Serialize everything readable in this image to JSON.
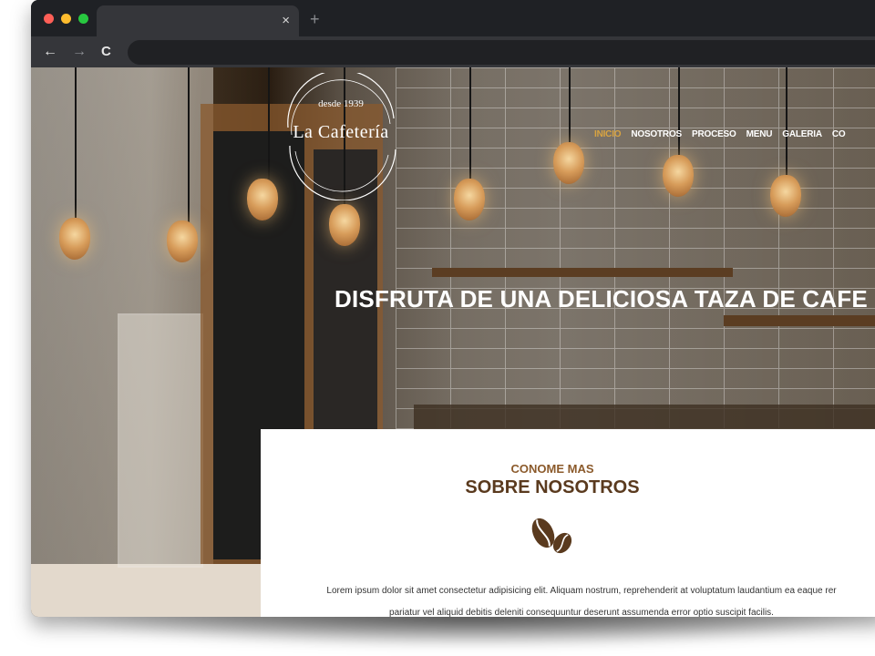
{
  "browser": {
    "tab_close": "×",
    "tab_new": "+",
    "nav": {
      "back": "←",
      "forward": "→",
      "reload": "C"
    }
  },
  "colors": {
    "accent": "#d9a441",
    "brown": "#5a3a1e",
    "brown_light": "#8b5a2b",
    "section_bg": "#e3d9cc"
  },
  "logo": {
    "since": "desde 1939",
    "name": "La Cafetería"
  },
  "menu": {
    "items": [
      "INICIO",
      "NOSOTROS",
      "PROCESO",
      "MENU",
      "GALERIA",
      "CO"
    ],
    "active_index": 0
  },
  "hero": {
    "title": "DISFRUTA DE UNA DELICIOSA TAZA DE CAFE"
  },
  "about": {
    "kicker": "CONOME MAS",
    "title": "SOBRE NOSOTROS",
    "icon": "coffee-beans-icon",
    "text_line1": "Lorem ipsum dolor sit amet consectetur adipisicing elit. Aliquam nostrum, reprehenderit at voluptatum laudantium ea eaque rer",
    "text_line2": "pariatur vel aliquid debitis deleniti consequuntur deserunt assumenda error optio suscipit facilis."
  }
}
